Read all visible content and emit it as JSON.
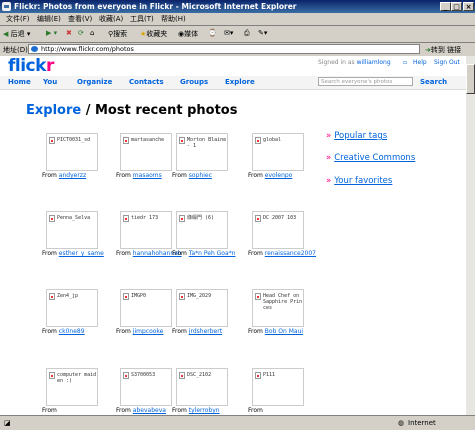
{
  "window": {
    "title": "Flickr: Photos from everyone in Flickr - Microsoft Internet Explorer"
  },
  "menu": [
    "文件(F)",
    "编辑(E)",
    "查看(V)",
    "收藏(A)",
    "工具(T)",
    "帮助(H)"
  ],
  "toolbar": {
    "back": "后退",
    "search": "搜索",
    "favorites": "收藏夹",
    "media": "媒体"
  },
  "address": {
    "label": "地址(D)",
    "url": "http://www.flickr.com/photos",
    "go": "转到",
    "links": "链接"
  },
  "status": {
    "zone": "Internet"
  },
  "flickr": {
    "logo_a": "flick",
    "logo_b": "r",
    "signed_in_prefix": "Signed in as",
    "username": "williamlong",
    "help": "Help",
    "sign_out": "Sign Out",
    "nav": [
      "Home",
      "You",
      "Organize",
      "Contacts",
      "Groups",
      "Explore"
    ],
    "search_placeholder": "Search everyone's photos",
    "search_button": "Search",
    "heading_link": "Explore",
    "heading_rest": " / Most recent photos",
    "side_links": [
      "Popular tags",
      "Creative Commons",
      "Your favorites"
    ],
    "from": "From",
    "photos": [
      {
        "alt": "PICT0031_sd",
        "user": "andyerzz"
      },
      {
        "alt": "martasanche",
        "user": "masaoms"
      },
      {
        "alt": "Morton Blaine - 1",
        "user": "sophiec"
      },
      {
        "alt": "global",
        "user": "evolenpo"
      },
      {
        "alt": "Penna_Selva",
        "user": "esther_y_same"
      },
      {
        "alt": "tiedr 173",
        "user": "hannahohannah"
      },
      {
        "alt": "綠緣門 (6)",
        "user": "Ta*n Peh Goa*n"
      },
      {
        "alt": "DC 2007 103",
        "user": "renaissance2007"
      },
      {
        "alt": "Zen4_jp",
        "user": "ck0ne89"
      },
      {
        "alt": "IMGP0",
        "user": "jimpcooke"
      },
      {
        "alt": "IMG_2029",
        "user": "jrdsherbert"
      },
      {
        "alt": "Head Chef on Sapphire Princes",
        "user": "Bob On Maui"
      },
      {
        "alt": "computer maiden :)",
        "user": ""
      },
      {
        "alt": "S3700053",
        "user": "abevabeva"
      },
      {
        "alt": "DSC_2102",
        "user": "tylerrobyn"
      },
      {
        "alt": "P111",
        "user": ""
      }
    ]
  }
}
